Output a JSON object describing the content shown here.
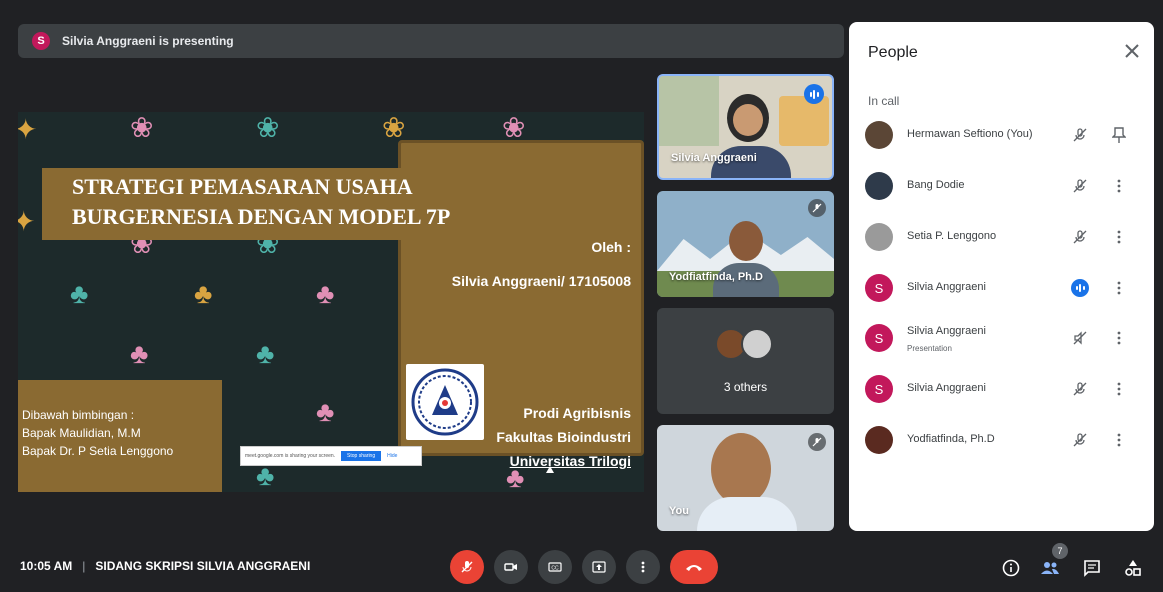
{
  "presenting": {
    "avatar_letter": "S",
    "text": "Silvia Anggraeni is presenting"
  },
  "slide": {
    "title": "STRATEGI PEMASARAN USAHA BURGERNESIA DENGAN MODEL 7P",
    "oleh": "Oleh :",
    "author": "Silvia Anggraeni/ 17105008",
    "inst_1": "Prodi Agribisnis",
    "inst_2": "Fakultas Bioindustri",
    "inst_3": "Universitas Trilogi",
    "supervisor_1": "Dibawah bimbingan :",
    "supervisor_2": "Bapak Maulidian, M.M",
    "supervisor_3": "Bapak Dr. P Setia Lenggono",
    "share_banner_text": "meet.google.com is sharing your screen.",
    "stop_sharing": "Stop sharing",
    "hide": "Hide"
  },
  "tiles": [
    {
      "name": "Silvia Anggraeni"
    },
    {
      "name": "Yodfiatfinda, Ph.D"
    },
    {
      "name": "3 others"
    },
    {
      "name": "You"
    }
  ],
  "people_panel": {
    "title": "People",
    "section": "In call",
    "participants": [
      {
        "name": "Hermawan Seftiono (You)",
        "avatar": "",
        "sub": ""
      },
      {
        "name": "Bang Dodie",
        "avatar": "",
        "sub": ""
      },
      {
        "name": "Setia P. Lenggono",
        "avatar": "",
        "sub": ""
      },
      {
        "name": "Silvia Anggraeni",
        "avatar": "S",
        "sub": ""
      },
      {
        "name": "Silvia Anggraeni",
        "avatar": "S",
        "sub": "Presentation"
      },
      {
        "name": "Silvia Anggraeni",
        "avatar": "S",
        "sub": ""
      },
      {
        "name": "Yodfiatfinda, Ph.D",
        "avatar": "",
        "sub": ""
      }
    ]
  },
  "bottom_bar": {
    "time": "10:05 AM",
    "separator": "|",
    "meeting_name": "SIDANG SKRIPSI SILVIA ANGGRAENI",
    "participant_count": "7"
  },
  "colors": {
    "accent": "#1a73e8",
    "danger": "#ea4335",
    "slide_brown": "#8a6a32",
    "avatar_pink": "#c2185b"
  }
}
